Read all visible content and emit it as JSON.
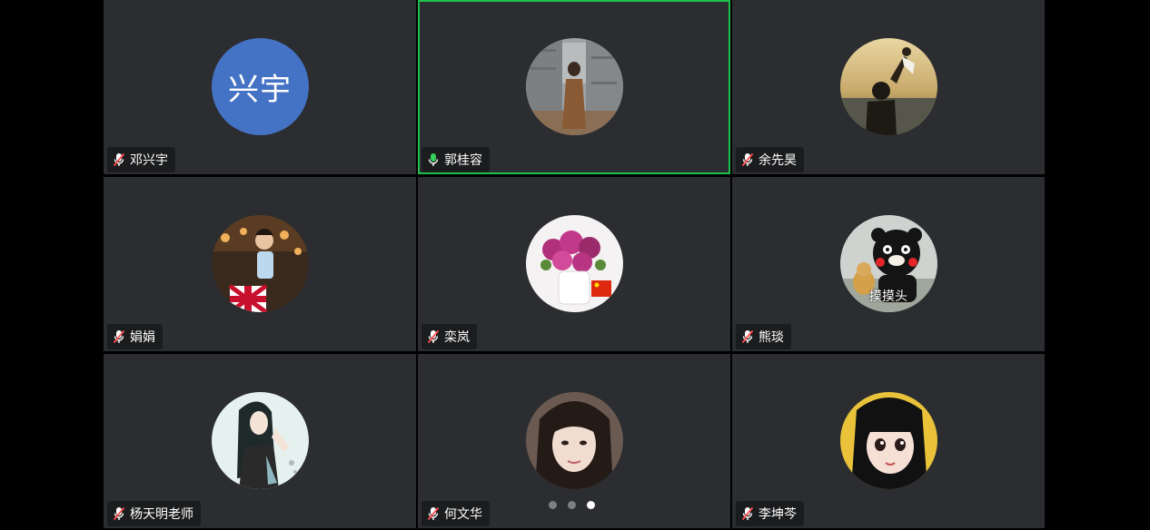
{
  "participants": [
    {
      "name": "邓兴宇",
      "initials": "兴宇",
      "avatar": "initials-avatar",
      "avatar_color": "#4472c4",
      "mic": "muted",
      "active": false
    },
    {
      "name": "郭桂容",
      "avatar": "photo-woman-stone-ruins",
      "mic": "speaking",
      "active": true
    },
    {
      "name": "余先昊",
      "avatar": "photo-sunset-father-child",
      "mic": "muted",
      "active": false
    },
    {
      "name": "娟娟",
      "avatar": "photo-child-union-jack",
      "mic": "muted",
      "active": false
    },
    {
      "name": "栾岚",
      "avatar": "photo-flowers-vase",
      "mic": "muted",
      "active": false
    },
    {
      "name": "熊琰",
      "avatar": "photo-kumamon-dog",
      "avatar_caption": "摸摸头",
      "mic": "muted",
      "active": false
    },
    {
      "name": "杨天明老师",
      "avatar": "illustration-woman-long-hair",
      "mic": "muted",
      "active": false
    },
    {
      "name": "何文华",
      "avatar": "photo-woman-selfie",
      "mic": "muted",
      "active": false
    },
    {
      "name": "李坤芩",
      "avatar": "illustration-anime-girl",
      "mic": "muted",
      "active": false
    }
  ],
  "pager": {
    "pages": 3,
    "current": 3
  },
  "colors": {
    "tile_bg": "#2b2d30",
    "active_border": "#1fbf4e",
    "muted_mic": "#ff4d4f",
    "speaking_mic": "#35d05b"
  }
}
